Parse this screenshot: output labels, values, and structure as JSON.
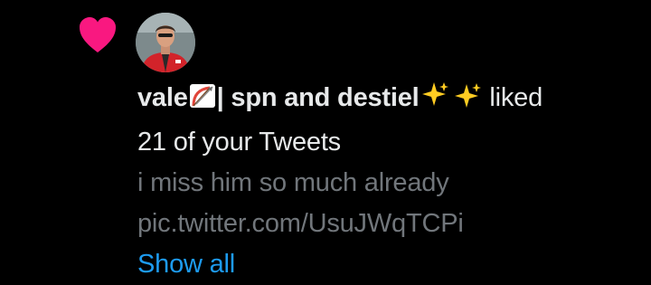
{
  "colors": {
    "background": "#000000",
    "heart": "#f91880",
    "text": "#e7e9ea",
    "muted": "#71767b",
    "link": "#1d9bf0"
  },
  "notification": {
    "icon": "heart-icon",
    "avatar_icon": "user-avatar",
    "user_name_part1": "vale",
    "user_name_emoji1": "bow-and-arrow-emoji",
    "user_name_part2": "| spn and destiel",
    "user_name_emoji2": "sparkles-emoji",
    "action_text": "liked",
    "count_text": "21 of your Tweets",
    "tweet_text": "i miss him so much already",
    "tweet_link": "pic.twitter.com/UsuJWqTCPi",
    "show_all_label": "Show all"
  }
}
